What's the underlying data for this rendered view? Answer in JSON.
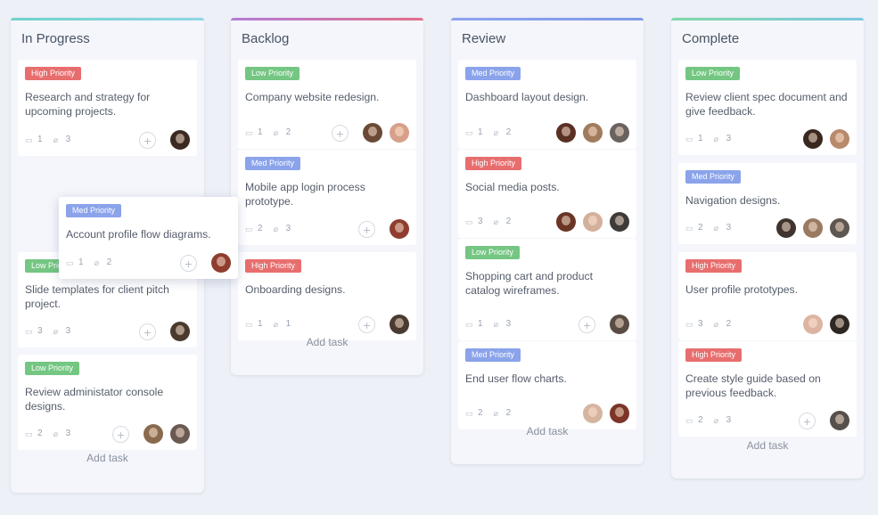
{
  "columns": [
    {
      "title": "In Progress",
      "add_task": "Add task",
      "color_a": "#6fd3c8",
      "color_b": "#8fd6e6",
      "cards": [
        {
          "priority": "High Priority",
          "title": "Research and strategy for upcoming projects.",
          "comments": "1",
          "attachments": "3",
          "add": "+",
          "avatars": [
            "#3a2a22"
          ]
        },
        {
          "priority": "Low Priority",
          "title": "Slide templates for client pitch project.",
          "comments": "3",
          "attachments": "3",
          "add": "+",
          "avatars": [
            "#4a3a2e"
          ]
        },
        {
          "priority": "Low Priority",
          "title": "Review administator console designs.",
          "comments": "2",
          "attachments": "3",
          "add": "+",
          "avatars": [
            "#8a6a4e",
            "#6a5a52"
          ]
        }
      ]
    },
    {
      "title": "Backlog",
      "add_task": "Add task",
      "color_a": "#b57cd8",
      "color_b": "#e26f8a",
      "cards": [
        {
          "priority": "Low Priority",
          "title": "Company website redesign.",
          "comments": "1",
          "attachments": "2",
          "add": "+",
          "avatars": [
            "#6b4a35",
            "#d7a08a"
          ]
        },
        {
          "priority": "Med Priority",
          "title": "Mobile app login process prototype.",
          "comments": "2",
          "attachments": "3",
          "add": "+",
          "avatars": [
            "#8e3d2f"
          ]
        },
        {
          "priority": "High Priority",
          "title": "Onboarding designs.",
          "comments": "1",
          "attachments": "1",
          "add": "+",
          "avatars": [
            "#4a3a30"
          ]
        }
      ]
    },
    {
      "title": "Review",
      "add_task": "Add task",
      "color_a": "#8da3f0",
      "color_b": "#7f9ae8",
      "cards": [
        {
          "priority": "Med Priority",
          "title": "Dashboard layout design.",
          "comments": "1",
          "attachments": "2",
          "add": "",
          "avatars": [
            "#5a3024",
            "#a07b5c",
            "#6a625e"
          ]
        },
        {
          "priority": "High Priority",
          "title": "Social media posts.",
          "comments": "3",
          "attachments": "2",
          "add": "",
          "avatars": [
            "#6b3526",
            "#d3b09c",
            "#3e3a38"
          ]
        },
        {
          "priority": "Low Priority",
          "title": "Shopping cart and product catalog wireframes.",
          "comments": "1",
          "attachments": "3",
          "add": "+",
          "avatars": [
            "#5a4c44"
          ]
        },
        {
          "priority": "Med Priority",
          "title": "End user flow charts.",
          "comments": "2",
          "attachments": "2",
          "add": "",
          "avatars": [
            "#d5b4a0",
            "#7c3526"
          ]
        }
      ]
    },
    {
      "title": "Complete",
      "add_task": "Add task",
      "color_a": "#7fd8a8",
      "color_b": "#7cc8e0",
      "cards": [
        {
          "priority": "Low Priority",
          "title": "Review client spec document and give feedback.",
          "comments": "1",
          "attachments": "3",
          "add": "",
          "avatars": [
            "#3a2820",
            "#b88a6c"
          ]
        },
        {
          "priority": "Med Priority",
          "title": "Navigation designs.",
          "comments": "2",
          "attachments": "3",
          "add": "",
          "avatars": [
            "#3f342e",
            "#9a7a60",
            "#5e5650"
          ]
        },
        {
          "priority": "High Priority",
          "title": "User profile prototypes.",
          "comments": "3",
          "attachments": "2",
          "add": "",
          "avatars": [
            "#dbb5a2",
            "#2e2824"
          ]
        },
        {
          "priority": "High Priority",
          "title": "Create style guide based on previous feedback.",
          "comments": "2",
          "attachments": "3",
          "add": "+",
          "avatars": [
            "#55504c"
          ]
        }
      ]
    }
  ],
  "dragging_card": {
    "priority": "Med Priority",
    "title": "Account profile flow diagrams.",
    "comments": "1",
    "attachments": "2",
    "add": "+",
    "avatars": [
      "#8e3d2f"
    ]
  },
  "icons": {
    "comment": "comment-icon",
    "attachment": "paperclip-icon",
    "add": "plus-icon"
  }
}
